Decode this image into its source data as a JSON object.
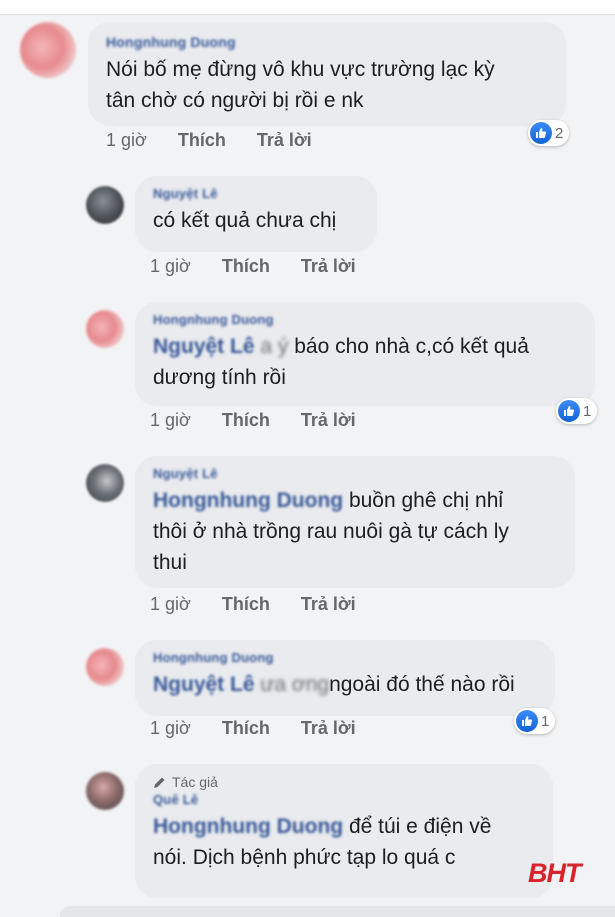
{
  "comments": [
    {
      "author": "Hongnhung Duong",
      "text": "Nói bố mẹ đừng vô khu vực trường lạc kỳ tân chờ có người bị rồi e nk",
      "line1": "Nói bố mẹ đừng vô khu vực trường lạc kỳ",
      "line2": "tân chờ có người bị rồi e nk",
      "time": "1 giờ",
      "like": "Thích",
      "reply": "Trả lời",
      "reactions": "2"
    },
    {
      "author": "Nguyệt Lê",
      "text": "có kết quả chưa chị",
      "time": "1 giờ",
      "like": "Thích",
      "reply": "Trả lời"
    },
    {
      "author": "Hongnhung Duong",
      "mention": "Nguyệt Lê",
      "mention_tail": "a ý",
      "text": "báo cho nhà c,có kết quả",
      "line2": "dương tính rồi",
      "time": "1 giờ",
      "like": "Thích",
      "reply": "Trả lời",
      "reactions": "1"
    },
    {
      "author": "Nguyệt Lê",
      "mention": "Hongnhung Duong",
      "text": "buồn ghê chị nhỉ",
      "line2": "thôi ở nhà trồng rau nuôi gà tự cách ly",
      "line3": "thui",
      "time": "1 giờ",
      "like": "Thích",
      "reply": "Trả lời"
    },
    {
      "author": "Hongnhung Duong",
      "mention": "Nguyệt Lê",
      "mention_tail": "ưa ơng",
      "text": "ngoài đó thế nào rồi",
      "time": "1 giờ",
      "like": "Thích",
      "reply": "Trả lời",
      "reactions": "1"
    },
    {
      "badge": "Tác giả",
      "author": "Quê Lê",
      "mention": "Hongnhung Duong",
      "text": " để túi e điện về",
      "line2": "nói. Dịch bệnh phức tạp lo quá c"
    }
  ],
  "watermark": "BHT",
  "colors": {
    "link": "#385898",
    "bubble": "#e9ebee",
    "like": "#1877f2",
    "watermark": "#d8232a"
  }
}
